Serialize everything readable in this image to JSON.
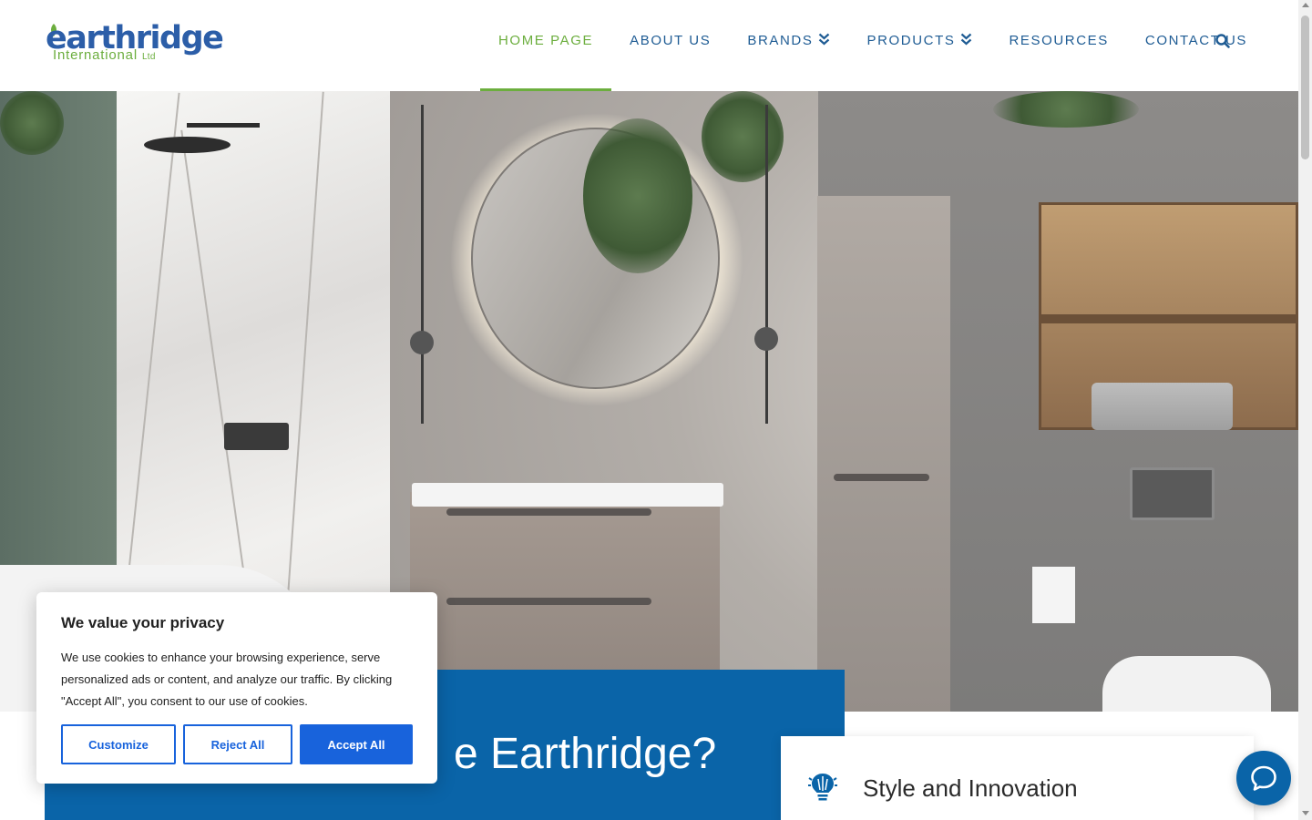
{
  "brand": {
    "name": "earthridge",
    "sub": "International",
    "ltd": "Ltd",
    "primary_color": "#2c5ea8",
    "accent_color": "#6cae3e"
  },
  "nav": {
    "items": [
      {
        "label": "HOME PAGE",
        "active": true
      },
      {
        "label": "ABOUT US",
        "active": false
      },
      {
        "label": "BRANDS",
        "active": false,
        "dropdown": true
      },
      {
        "label": "PRODUCTS",
        "active": false,
        "dropdown": true
      },
      {
        "label": "RESOURCES",
        "active": false
      },
      {
        "label": "CONTACT US",
        "active": false
      }
    ],
    "search_icon": "search-icon"
  },
  "hero": {
    "image": "bathroom-interior-photo"
  },
  "section": {
    "title": "e Earthridge?",
    "panel_color": "#0a64a8"
  },
  "feature": {
    "title": "Style and Innovation",
    "icon": "lightbulb-icon"
  },
  "cookie": {
    "title": "We value your privacy",
    "text": "We use cookies to enhance your browsing experience, serve personalized ads or content, and analyze our traffic. By clicking \"Accept All\", you consent to our use of cookies.",
    "customize": "Customize",
    "reject": "Reject All",
    "accept": "Accept All",
    "button_color": "#1863dc"
  },
  "chat": {
    "icon": "chat-bubble-icon"
  }
}
